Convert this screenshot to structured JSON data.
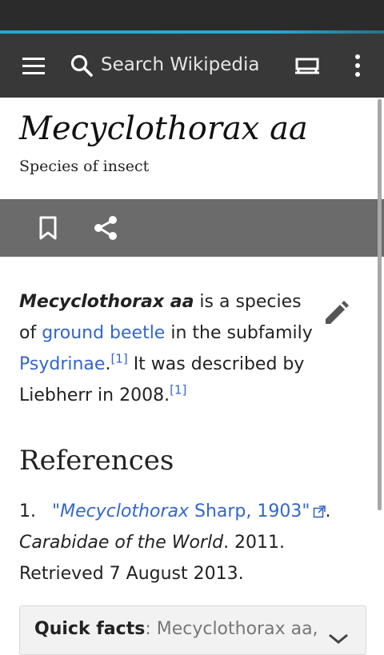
{
  "toolbar": {
    "search_placeholder": "Search Wikipedia"
  },
  "article": {
    "title": "Mecyclothorax aa",
    "subtitle": "Species of insect",
    "intro": {
      "bold_name": "Mecyclothorax aa",
      "t1": " is a species of ",
      "link_ground_beetle": "ground beetle",
      "t2": " in the subfamily ",
      "link_psydrinae": "Psydrinae",
      "t3": ".",
      "cite1": "[1]",
      "t4": " It was described by Liebherr in 2008.",
      "cite2": "[1]"
    },
    "references_heading": "References",
    "references": [
      {
        "num": "1.",
        "link_open_quote": "\"",
        "link_italic": "Mecyclothorax",
        "link_rest": " Sharp, 1903",
        "link_close_quote": "\"",
        "after_link": ". ",
        "source_italic": "Carabidae of the World",
        "rest": ". 2011. Retrieved 7 August 2013."
      }
    ],
    "quick_facts": {
      "label": "Quick facts",
      "sep": ": ",
      "text": "Mecyclothorax aa,"
    }
  },
  "colors": {
    "toolbar_bg": "#383838",
    "accent": "#2ba9cf",
    "link": "#3366cc",
    "action_bar_bg": "#6b6b6b"
  },
  "icons": {
    "menu": "hamburger-menu-icon",
    "search": "search-icon",
    "tabs": "tabs-icon",
    "overflow": "more-vert-icon",
    "bookmark": "bookmark-icon",
    "share": "share-icon",
    "edit": "edit-pencil-icon",
    "external": "external-link-icon",
    "chevron": "chevron-down-icon"
  }
}
